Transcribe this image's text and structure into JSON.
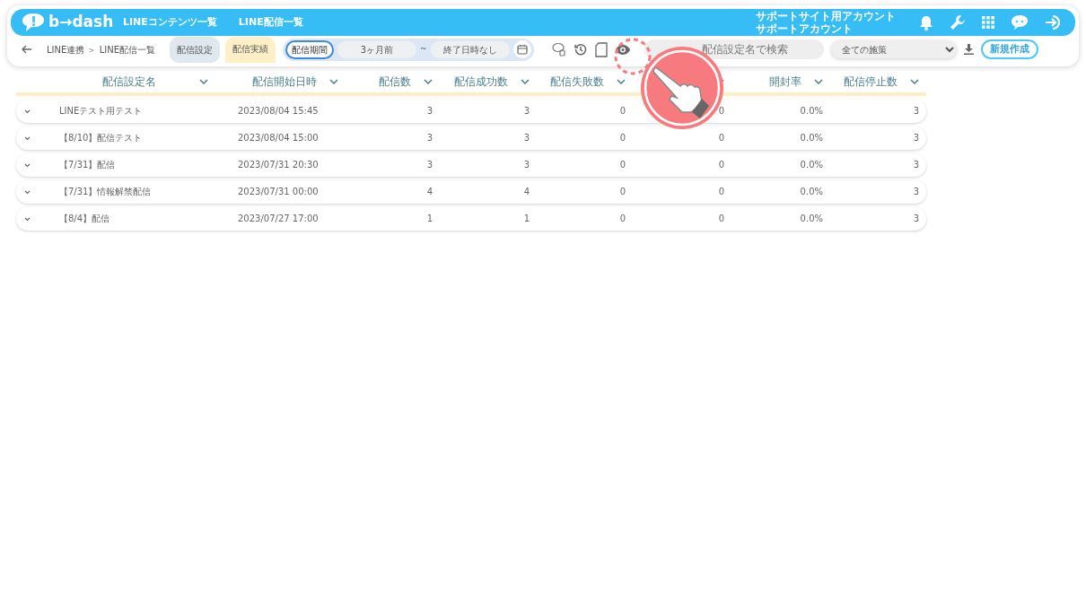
{
  "header": {
    "logo": "b→dash",
    "nav": [
      {
        "label": "LINEコンテンツ一覧"
      },
      {
        "label": "LINE配信一覧"
      }
    ],
    "account": [
      "サポートサイト用アカウント",
      "サポートアカウント"
    ]
  },
  "toolbar": {
    "breadcrumb": "LINE連携 ＞ LINE配信一覧",
    "tabs": [
      {
        "label": "配信設定",
        "selected": false
      },
      {
        "label": "配信実績",
        "selected": true
      }
    ],
    "period": {
      "label": "配信期間",
      "from": "3ヶ月前",
      "separator": "~",
      "to": "終了日時なし"
    },
    "search": {
      "placeholder": "配信設定名で検索"
    },
    "filter": "全ての施策",
    "new_button": "新規作成"
  },
  "table": {
    "columns": [
      {
        "label": "配信設定名"
      },
      {
        "label": "配信開始日時"
      },
      {
        "label": "配信数"
      },
      {
        "label": "配信成功数"
      },
      {
        "label": "配信失敗数"
      },
      {},
      {
        "label": "開封率"
      },
      {
        "label": "配信停止数"
      }
    ],
    "rows": [
      {
        "cells": [
          "LINEテスト用テスト",
          "2023/08/04 15:45",
          "3",
          "3",
          "0",
          "0",
          "0.0%",
          "3"
        ]
      },
      {
        "cells": [
          "【8/10】配信テスト",
          "2023/08/04 15:00",
          "3",
          "3",
          "0",
          "0",
          "0.0%",
          "3"
        ]
      },
      {
        "cells": [
          "【7/31】配信",
          "2023/07/31 20:30",
          "3",
          "3",
          "0",
          "0",
          "0.0%",
          "3"
        ]
      },
      {
        "cells": [
          "【7/31】情報解禁配信",
          "2023/07/31 00:00",
          "4",
          "4",
          "0",
          "0",
          "0.0%",
          "3"
        ]
      },
      {
        "cells": [
          "【8/4】配信",
          "2023/07/27 17:00",
          "1",
          "1",
          "0",
          "0",
          "0.0%",
          "3"
        ]
      }
    ]
  }
}
